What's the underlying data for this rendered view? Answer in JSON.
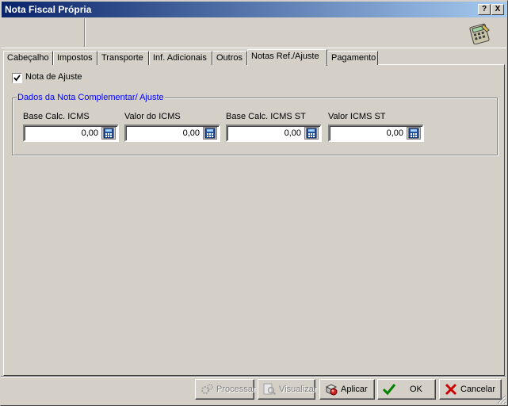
{
  "window": {
    "title": "Nota Fiscal Própria",
    "help_label": "?",
    "close_label": "X"
  },
  "tabs": [
    {
      "label": "Cabeçalho"
    },
    {
      "label": "Impostos"
    },
    {
      "label": "Transporte"
    },
    {
      "label": "Inf. Adicionais"
    },
    {
      "label": "Outros"
    },
    {
      "label": "Notas Ref./Ajuste",
      "active": true
    },
    {
      "label": "Pagamento"
    }
  ],
  "ajuste": {
    "checkbox_label": "Nota de Ajuste",
    "checked": true
  },
  "group": {
    "title": "Dados da Nota Complementar/ Ajuste",
    "fields": [
      {
        "label": "Base Calc. ICMS",
        "value": "0,00"
      },
      {
        "label": "Valor do ICMS",
        "value": "0,00"
      },
      {
        "label": "Base Calc. ICMS ST",
        "value": "0,00"
      },
      {
        "label": "Valor ICMS ST",
        "value": "0,00"
      }
    ]
  },
  "buttons": {
    "processar": "Processar",
    "visualizar": "Visualizar",
    "aplicar": "Aplicar",
    "ok": "OK",
    "cancelar": "Cancelar"
  },
  "colors": {
    "title_gradient_start": "#0a246a",
    "title_gradient_end": "#a6caf0",
    "group_title": "#0000ff",
    "ok_check": "#008000",
    "cancel_x": "#cc0000"
  }
}
